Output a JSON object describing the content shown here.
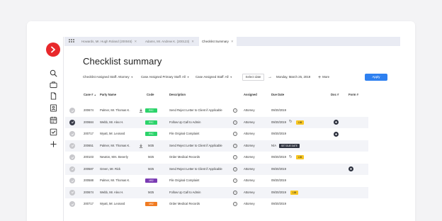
{
  "tabs": [
    {
      "label": "Howards, Mr. Hugh Roland (200045)",
      "active": false
    },
    {
      "label": "Adams, Mr. Andrew K. (200123)",
      "active": false
    },
    {
      "label": "Checklist Summary",
      "active": true
    }
  ],
  "page_title": "Checklist summary",
  "filters": {
    "assigned_staff": "Checklist Assigned Staff: Attorney",
    "primary_staff": "Case Assigned Primary Staff: All",
    "case_staff": "Case Assigned Staff: All",
    "select_date": "Select date",
    "date_value": "Monday, March 25, 2019",
    "more": "More",
    "apply": "Apply"
  },
  "columns": {
    "case": "Case #",
    "party": "Party Name",
    "code": "Code",
    "description": "Description",
    "assigned": "Assigned",
    "due": "Due Date",
    "doc": "Doc #",
    "form": "Form #"
  },
  "icons": {
    "logo": "chevron-right-icon",
    "nav": [
      "search-icon",
      "briefcase-icon",
      "document-icon",
      "contact-card-icon",
      "calendar-icon",
      "checklist-icon",
      "plus-icon"
    ]
  },
  "colors": {
    "accent": "#2e80f0",
    "logo": "#e8282b",
    "green": "#2bd36a",
    "purple": "#7a3bb3",
    "orange": "#f07b22",
    "yellow": "#f7c623",
    "dark": "#2f3340"
  },
  "rows": [
    {
      "case": "200674",
      "party": "Palmer, Mr. Thomas K.",
      "code": "RSC",
      "code_style": "green",
      "download": true,
      "description": "Send Reject Letter to Client if Applicable",
      "assigned": "Attorney",
      "due": "09/20/2019",
      "checked": false,
      "alt": false,
      "refresh": false,
      "badge": "",
      "doc_plus": false,
      "form_plus": false
    },
    {
      "case": "200684",
      "party": "Webb, Mr. Alex H.",
      "code": "RSC",
      "code_style": "green",
      "download": false,
      "description": "Follow Up Call to Admin",
      "assigned": "Attorney",
      "due": "09/20/2019",
      "checked": true,
      "alt": true,
      "refresh": true,
      "badge": "LIM",
      "badge_style": "yellow",
      "doc_plus": true,
      "form_plus": false
    },
    {
      "case": "200717",
      "party": "Wyatt, Mr. Leonard",
      "code": "RSC",
      "code_style": "green",
      "download": false,
      "description": "File Original Complaint",
      "assigned": "Attorney",
      "due": "09/20/2019",
      "checked": false,
      "alt": false,
      "refresh": false,
      "badge": "",
      "doc_plus": true,
      "form_plus": false
    },
    {
      "case": "200651",
      "party": "Palmer, Mr. Thomas K.",
      "code": "M35",
      "code_style": "text",
      "download": true,
      "description": "Send Reject Letter to Client if Applicable",
      "assigned": "Attorney",
      "due": "N/A",
      "checked": false,
      "alt": true,
      "refresh": false,
      "badge": "SET DUE DATE",
      "badge_style": "dark",
      "doc_plus": false,
      "form_plus": false
    },
    {
      "case": "200103",
      "party": "Newton, Mrs. Beverly",
      "code": "M25",
      "code_style": "text",
      "download": false,
      "description": "Order Medical Records",
      "assigned": "Attorney",
      "due": "09/20/2019",
      "checked": false,
      "alt": false,
      "refresh": true,
      "badge": "LIM",
      "badge_style": "yellow",
      "doc_plus": false,
      "form_plus": false
    },
    {
      "case": "200587",
      "party": "Green, Mr. Rick",
      "code": "M25",
      "code_style": "text",
      "download": false,
      "description": "Send Reject Letter to Client if Applicable",
      "assigned": "Attorney",
      "due": "09/20/2019",
      "checked": false,
      "alt": true,
      "refresh": false,
      "badge": "",
      "doc_plus": false,
      "form_plus": true
    },
    {
      "case": "200588",
      "party": "Palmer, Mr. Thomas K.",
      "code": "M52",
      "code_style": "purple",
      "download": false,
      "description": "File Original Complaint",
      "assigned": "Attorney",
      "due": "09/20/2019",
      "checked": false,
      "alt": false,
      "refresh": false,
      "badge": "",
      "doc_plus": false,
      "form_plus": false
    },
    {
      "case": "200674",
      "party": "Webb, Mr. Alex H.",
      "code": "M25",
      "code_style": "text",
      "download": false,
      "description": "Follow Up Call to Admin",
      "assigned": "Attorney",
      "due": "09/20/2019",
      "checked": false,
      "alt": true,
      "refresh": false,
      "badge": "LIM",
      "badge_style": "yellow",
      "doc_plus": false,
      "form_plus": false
    },
    {
      "case": "200717",
      "party": "Wyatt, Mr. Leonard",
      "code": "M52",
      "code_style": "orange",
      "download": false,
      "description": "Order Medical Records",
      "assigned": "Attorney",
      "due": "09/20/2019",
      "checked": false,
      "alt": false,
      "refresh": false,
      "badge": "",
      "doc_plus": false,
      "form_plus": false
    }
  ]
}
